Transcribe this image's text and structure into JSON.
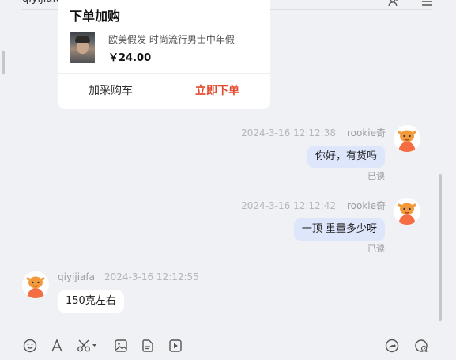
{
  "header": {
    "title": "qiyijiafa",
    "add_user_icon": "add-user-icon",
    "menu_icon": "menu-icon"
  },
  "order_card": {
    "title": "下单加购",
    "product_name": "欧美假发 时尚流行男士中年假",
    "price": "￥24.00",
    "add_to_cart": "加采购车",
    "buy_now": "立即下单",
    "buy_color": "#e4482c"
  },
  "messages": [
    {
      "side": "right",
      "timestamp": "2024-3-16 12:12:38",
      "sender": "rookie奇",
      "text": "你好，有货吗",
      "status": "已读"
    },
    {
      "side": "right",
      "timestamp": "2024-3-16 12:12:42",
      "sender": "rookie奇",
      "text": "一顶 重量多少呀",
      "status": "已读"
    },
    {
      "side": "left",
      "timestamp": "2024-3-16 12:12:55",
      "sender": "qiyijiafa",
      "text": "150克左右"
    }
  ],
  "toolbar": {
    "icons": [
      "emoji-icon",
      "font-icon",
      "scissors-icon",
      "image-icon",
      "file-icon",
      "video-icon",
      "forward-icon",
      "quick-reply-icon"
    ]
  },
  "colors": {
    "background": "#f0f1f5",
    "my_bubble": "#dde6fb",
    "other_bubble": "#ffffff",
    "accent": "#e4482c"
  }
}
